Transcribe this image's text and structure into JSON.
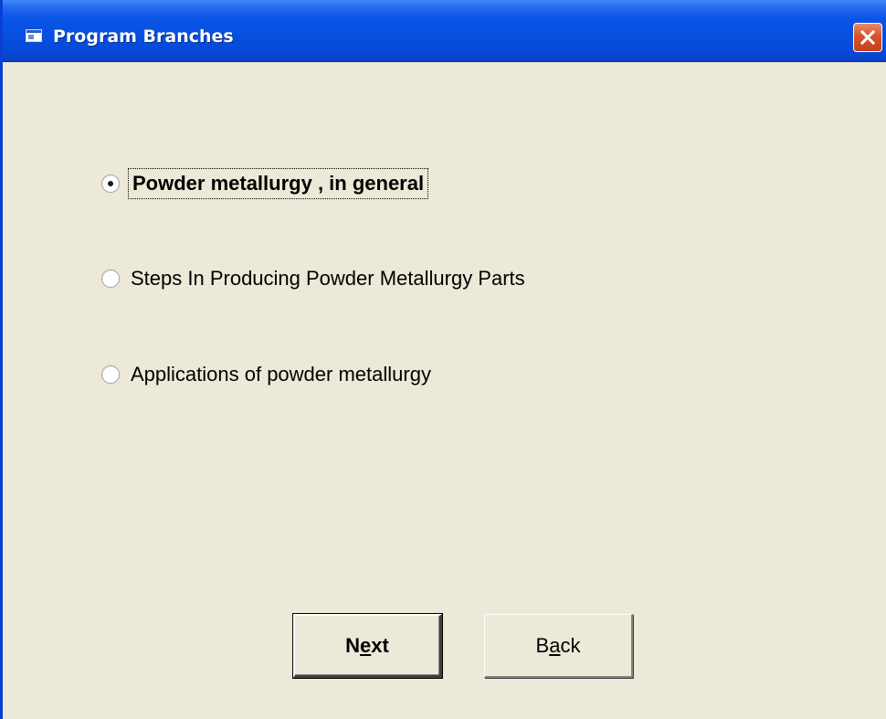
{
  "window": {
    "title": "Program Branches"
  },
  "options": [
    {
      "label": "Powder metallurgy , in general",
      "selected": true
    },
    {
      "label": "Steps In Producing Powder Metallurgy Parts",
      "selected": false
    },
    {
      "label": "Applications of powder metallurgy",
      "selected": false
    }
  ],
  "buttons": {
    "next": {
      "pre": "N",
      "accel": "e",
      "post": "xt"
    },
    "back": {
      "pre": "B",
      "accel": "a",
      "post": "ck"
    }
  },
  "icons": {
    "title": "window-icon",
    "close": "close-icon"
  },
  "colors": {
    "titlebar": "#0550e0",
    "background": "#ece9d8",
    "close_button": "#d9532e"
  }
}
